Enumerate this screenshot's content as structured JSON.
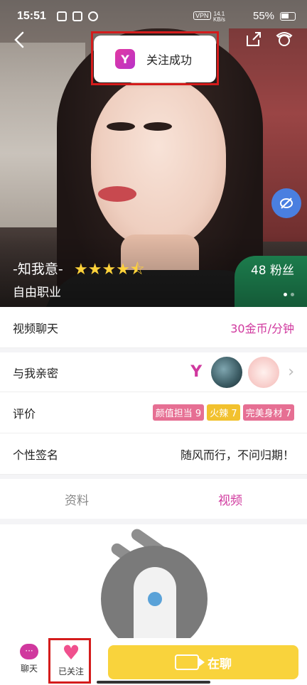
{
  "status_bar": {
    "time": "15:51",
    "vpn": "VPN",
    "net_speed_top": "14.1",
    "net_speed_unit": "KB/s",
    "battery": "55%"
  },
  "toast": {
    "logo": "Y",
    "text": "关注成功"
  },
  "profile": {
    "name": "-知我意-",
    "job": "自由职业",
    "fans": "48 粉丝",
    "stars": "★★★★⯪",
    "rating": 4.5
  },
  "rows": {
    "video_chat": {
      "label": "视频聊天",
      "value": "30金币/分钟"
    },
    "intimacy": {
      "label": "与我亲密",
      "logo": "Y"
    },
    "rating": {
      "label": "评价",
      "tags": [
        "颜值担当 9",
        "火辣 7",
        "完美身材 7"
      ]
    },
    "signature": {
      "label": "个性签名",
      "value": "随风而行，不问归期！"
    }
  },
  "tabs": [
    {
      "label": "资料",
      "active": false
    },
    {
      "label": "视频",
      "active": true
    }
  ],
  "bottom_bar": {
    "chat_label": "聊天",
    "chat_icon": "···",
    "follow_label": "已关注",
    "follow_icon": "♥",
    "live_label": "在聊"
  },
  "colors": {
    "accent": "#d0389e",
    "live_button": "#f9d33c",
    "toast_highlight": "#d41c1c"
  }
}
